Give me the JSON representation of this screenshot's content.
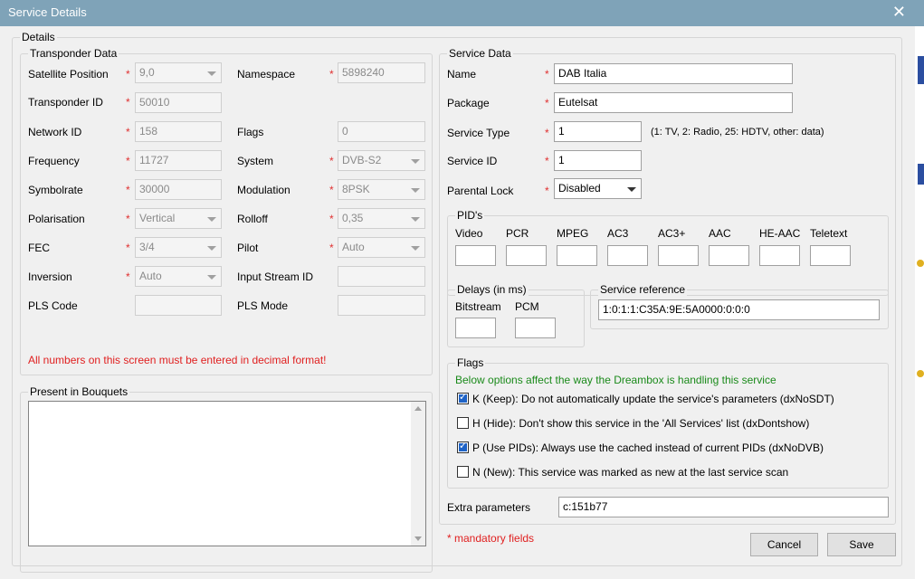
{
  "window": {
    "title": "Service Details",
    "close_symbol": "✕"
  },
  "details": {
    "legend": "Details",
    "transponder": {
      "legend": "Transponder Data",
      "satellite_position": {
        "label": "Satellite Position",
        "value": "9,0"
      },
      "namespace": {
        "label": "Namespace",
        "value": "5898240"
      },
      "transponder_id": {
        "label": "Transponder ID",
        "value": "50010"
      },
      "network_id": {
        "label": "Network ID",
        "value": "158"
      },
      "flags": {
        "label": "Flags",
        "value": "0"
      },
      "frequency": {
        "label": "Frequency",
        "value": "11727"
      },
      "system": {
        "label": "System",
        "value": "DVB-S2"
      },
      "symbolrate": {
        "label": "Symbolrate",
        "value": "30000"
      },
      "modulation": {
        "label": "Modulation",
        "value": "8PSK"
      },
      "polarisation": {
        "label": "Polarisation",
        "value": "Vertical"
      },
      "rolloff": {
        "label": "Rolloff",
        "value": "0,35"
      },
      "fec": {
        "label": "FEC",
        "value": "3/4"
      },
      "pilot": {
        "label": "Pilot",
        "value": "Auto"
      },
      "inversion": {
        "label": "Inversion",
        "value": "Auto"
      },
      "input_stream_id": {
        "label": "Input Stream ID",
        "value": ""
      },
      "pls_code": {
        "label": "PLS Code",
        "value": ""
      },
      "pls_mode": {
        "label": "PLS Mode",
        "value": ""
      },
      "warning": "All numbers on this screen must be entered in decimal format!"
    },
    "bouquets": {
      "legend": "Present in Bouquets"
    },
    "service": {
      "legend": "Service Data",
      "name": {
        "label": "Name",
        "value": "DAB  Italia"
      },
      "package": {
        "label": "Package",
        "value": "Eutelsat"
      },
      "service_type": {
        "label": "Service Type",
        "value": "1",
        "hint": "(1: TV, 2: Radio, 25: HDTV, other: data)"
      },
      "service_id": {
        "label": "Service ID",
        "value": "1"
      },
      "parental_lock": {
        "label": "Parental Lock",
        "value": "Disabled"
      },
      "pids": {
        "legend": "PID's",
        "columns": [
          "Video",
          "PCR",
          "MPEG",
          "AC3",
          "AC3+",
          "AAC",
          "HE-AAC",
          "Teletext"
        ]
      },
      "delays": {
        "legend": "Delays (in ms)",
        "columns": [
          "Bitstream",
          "PCM"
        ]
      },
      "service_reference": {
        "legend": "Service reference",
        "value": "1:0:1:1:C35A:9E:5A0000:0:0:0"
      },
      "flags": {
        "legend": "Flags",
        "note": "Below options affect the way the Dreambox is handling this service",
        "options": [
          {
            "label": "K (Keep): Do not automatically update the service's parameters (dxNoSDT)",
            "checked": true
          },
          {
            "label": "H (Hide): Don't show this service in the 'All Services' list (dxDontshow)",
            "checked": false
          },
          {
            "label": "P (Use PIDs): Always use the cached instead of current PIDs (dxNoDVB)",
            "checked": true
          },
          {
            "label": "N (New): This service was marked as new at the last service scan",
            "checked": false
          }
        ]
      },
      "extra_parameters": {
        "label": "Extra parameters",
        "value": "c:151b77"
      }
    }
  },
  "mandatory_note": "* mandatory fields",
  "mandatory_star": "*",
  "buttons": {
    "cancel": "Cancel",
    "save": "Save"
  },
  "colors": {
    "titlebar": "#7fa3b8",
    "mandatory": "#e02020",
    "note_green": "#1a8a1a",
    "check_blue": "#1f63c6"
  }
}
